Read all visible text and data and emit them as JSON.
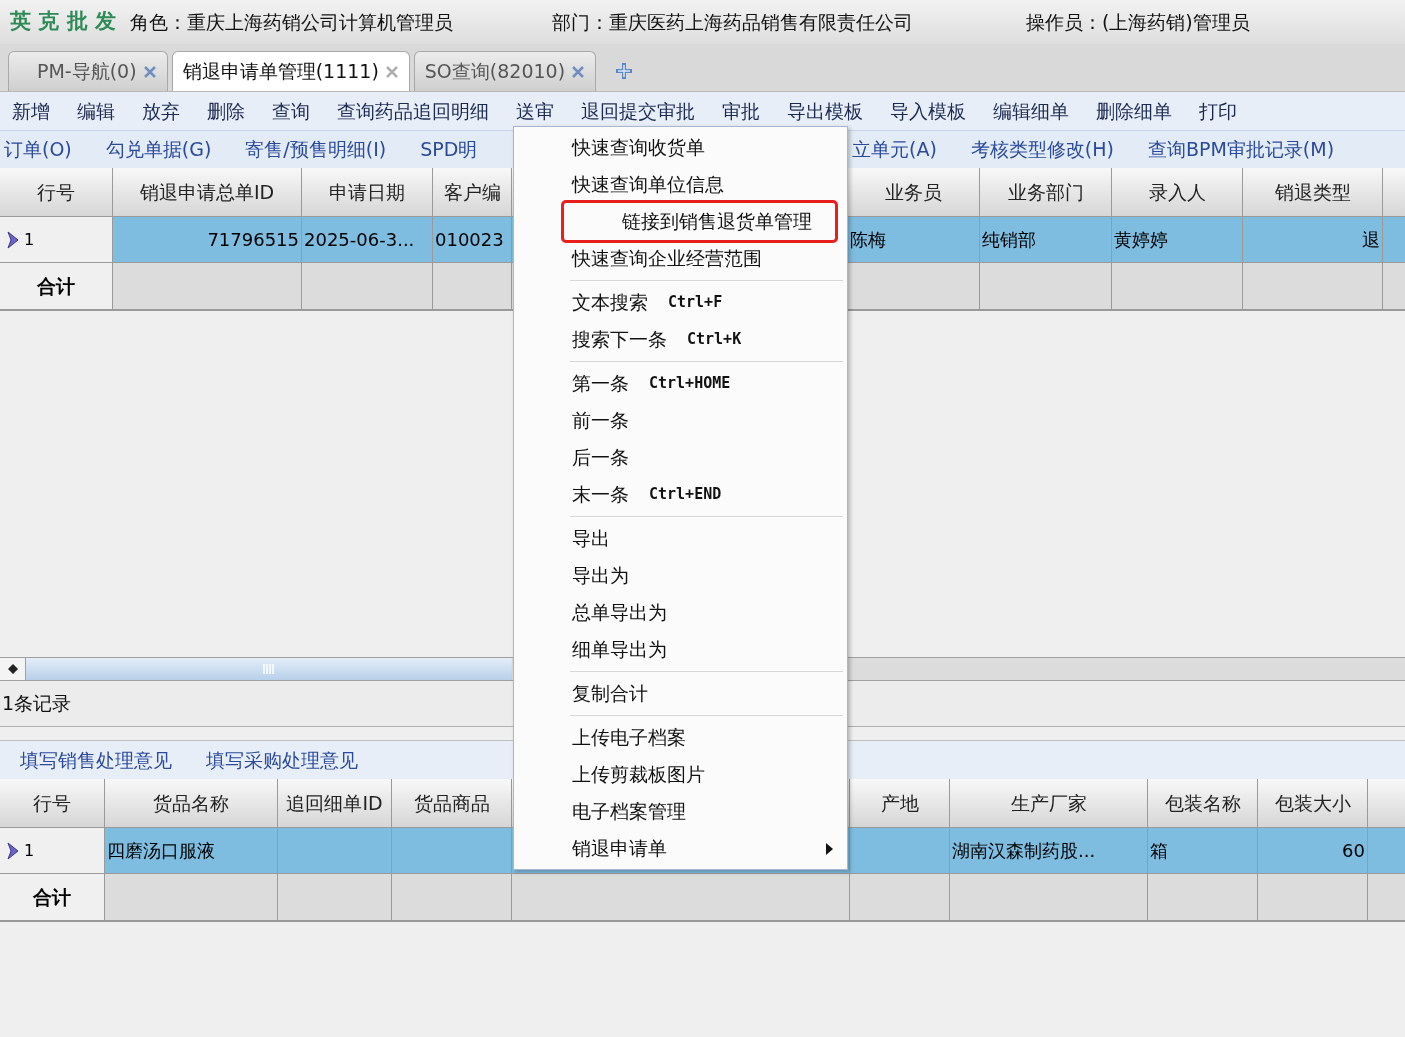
{
  "header": {
    "logo": "英 克 批 发",
    "role": "角色：重庆上海药销公司计算机管理员",
    "department": "部门：重庆医药上海药品销售有限责任公司",
    "operator": "操作员：(上海药销)管理员"
  },
  "tabs": [
    {
      "label": "PM-导航(0)",
      "selected": false
    },
    {
      "label": "销退申请单管理(1111)",
      "selected": true
    },
    {
      "label": "SO查询(82010)",
      "selected": false
    }
  ],
  "toolbar": [
    "新增",
    "编辑",
    "放弃",
    "删除",
    "查询",
    "查询药品追回明细",
    "送审",
    "退回提交审批",
    "审批",
    "导出模板",
    "导入模板",
    "编辑细单",
    "删除细单",
    "打印"
  ],
  "toolbar_2": {
    "left": [
      "订单(O)",
      "勾兑单据(G)",
      "寄售/预售明细(I)",
      "SPD明"
    ],
    "right": [
      "立单元(A)",
      "考核类型修改(H)",
      "查询BPM审批记录(M)"
    ]
  },
  "master_grid": {
    "columns_left": [
      "行号",
      "销退申请总单ID",
      "申请日期",
      "客户编"
    ],
    "columns_right": [
      "业务员",
      "业务部门",
      "录入人",
      "销退类型"
    ],
    "rows": [
      {
        "selected": true,
        "cells_left": {
          "0": "1",
          "1": "71796515",
          "2": "2025-06-3...",
          "3": "010023"
        },
        "cells_right": {
          "0": "陈梅",
          "1": "纯销部",
          "2": "黄婷婷",
          "3": "退"
        }
      }
    ],
    "total_label": "合计"
  },
  "status": "1条记录",
  "detail_toolbar": [
    "填写销售处理意见",
    "填写采购处理意见"
  ],
  "detail_grid": {
    "columns_left": [
      "行号",
      "货品名称",
      "追回细单ID",
      "货品商品"
    ],
    "columns_right": [
      "产地",
      "生产厂家",
      "包装名称",
      "包装大小"
    ],
    "rows": [
      {
        "selected": true,
        "cells_left": {
          "0": "1",
          "1": "四磨汤口服液"
        },
        "cells_right": {
          "1": "湖南汉森制药股...",
          "2": "箱",
          "3": "60"
        }
      }
    ],
    "total_label": "合计"
  },
  "context_menu": [
    {
      "kind": "item",
      "label": "快速查询收货单",
      "highlighted": false
    },
    {
      "kind": "item",
      "label": "快速查询单位信息",
      "highlighted": false
    },
    {
      "kind": "item",
      "label": "链接到销售退货单管理",
      "highlighted": true
    },
    {
      "kind": "item",
      "label": "快速查询企业经营范围",
      "highlighted": false
    },
    {
      "kind": "separator"
    },
    {
      "kind": "item",
      "label": "文本搜索",
      "shortcut": "Ctrl+F",
      "highlighted": false
    },
    {
      "kind": "item",
      "label": "搜索下一条",
      "shortcut": "Ctrl+K",
      "highlighted": false
    },
    {
      "kind": "separator"
    },
    {
      "kind": "item",
      "label": "第一条",
      "shortcut": "Ctrl+HOME",
      "highlighted": false
    },
    {
      "kind": "item",
      "label": "前一条",
      "highlighted": false
    },
    {
      "kind": "item",
      "label": "后一条",
      "highlighted": false
    },
    {
      "kind": "item",
      "label": "末一条",
      "shortcut": "Ctrl+END",
      "highlighted": false
    },
    {
      "kind": "separator"
    },
    {
      "kind": "item",
      "label": "导出",
      "highlighted": false
    },
    {
      "kind": "item",
      "label": "导出为",
      "highlighted": false
    },
    {
      "kind": "item",
      "label": "总单导出为",
      "highlighted": false
    },
    {
      "kind": "item",
      "label": "细单导出为",
      "highlighted": false
    },
    {
      "kind": "separator"
    },
    {
      "kind": "item",
      "label": "复制合计",
      "highlighted": false
    },
    {
      "kind": "separator"
    },
    {
      "kind": "item",
      "label": "上传电子档案",
      "highlighted": false
    },
    {
      "kind": "item",
      "label": "上传剪裁板图片",
      "highlighted": false
    },
    {
      "kind": "item",
      "label": "电子档案管理",
      "highlighted": false
    },
    {
      "kind": "submenu",
      "label": "销退申请单",
      "highlighted": false
    }
  ]
}
